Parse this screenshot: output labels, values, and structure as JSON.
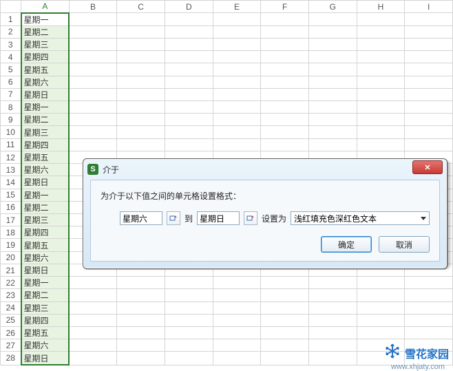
{
  "columns": [
    "A",
    "B",
    "C",
    "D",
    "E",
    "F",
    "G",
    "H",
    "I"
  ],
  "rows": [
    "星期一",
    "星期二",
    "星期三",
    "星期四",
    "星期五",
    "星期六",
    "星期日",
    "星期一",
    "星期二",
    "星期三",
    "星期四",
    "星期五",
    "星期六",
    "星期日",
    "星期一",
    "星期二",
    "星期三",
    "星期四",
    "星期五",
    "星期六",
    "星期日",
    "星期一",
    "星期二",
    "星期三",
    "星期四",
    "星期五",
    "星期六",
    "星期日"
  ],
  "dialog": {
    "title": "介于",
    "instruction": "为介于以下值之间的单元格设置格式：",
    "value1": "星期六",
    "to_label": "到",
    "value2": "星期日",
    "set_as_label": "设置为",
    "format_option": "浅红填充色深红色文本",
    "ok_label": "确定",
    "cancel_label": "取消"
  },
  "watermark": {
    "text": "雪花家园",
    "sub": "www.xhjaty.com"
  },
  "icon_letter": "S"
}
